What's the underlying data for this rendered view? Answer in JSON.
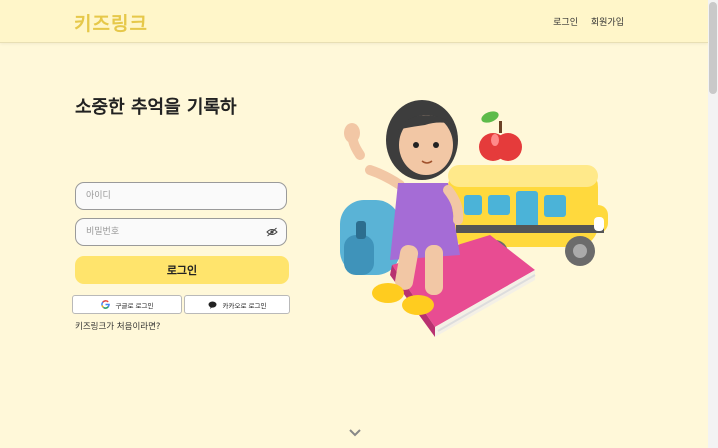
{
  "header": {
    "logo": "키즈링크",
    "nav": {
      "login": "로그인",
      "signup": "회원가입"
    }
  },
  "main": {
    "headline": "소중한 추억을 기록하",
    "id_field": {
      "placeholder": "아이디",
      "value": ""
    },
    "password_field": {
      "placeholder": "비밀번호",
      "value": ""
    },
    "login_button": "로그인",
    "google_button": "구글로 로그인",
    "kakao_button": "카카오로 로그인",
    "first_time_link": "키즈링크가 처음이라면?"
  },
  "colors": {
    "background": "#fff8d9",
    "logo": "#e6c84a",
    "login_button": "#ffe46c"
  },
  "icons": [
    "eye-off-icon",
    "google-icon",
    "kakao-icon",
    "chevron-down-icon"
  ]
}
